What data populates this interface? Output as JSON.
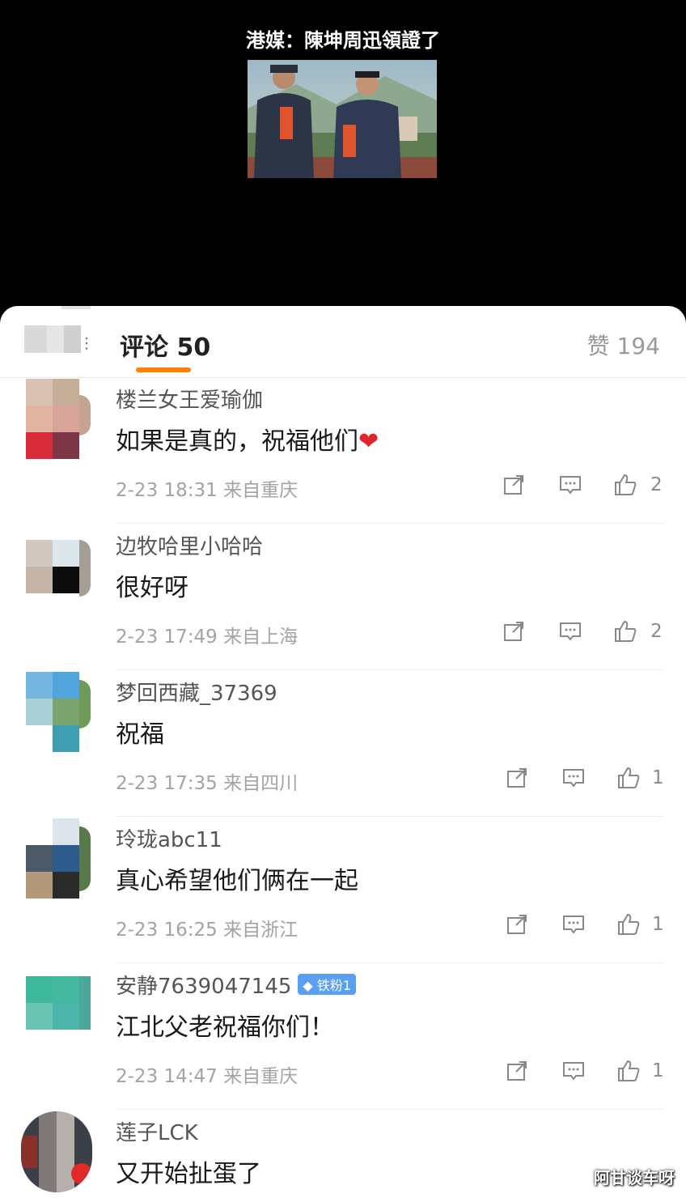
{
  "video": {
    "title": "港媒：陳坤周迅領證了"
  },
  "tabs": {
    "comments_label": "评论 50",
    "likes_label": "赞 194"
  },
  "comments": [
    {
      "username": "楼兰女王爱瑜伽",
      "text": "如果是真的，祝福他们",
      "emoji": "❤",
      "date": "2-23 18:31",
      "location": "来自重庆",
      "likes": "2"
    },
    {
      "username": "边牧哈里小哈哈",
      "text": "很好呀",
      "date": "2-23 17:49",
      "location": "来自上海",
      "likes": "2"
    },
    {
      "username": "梦回西藏_37369",
      "text": "祝福",
      "date": "2-23 17:35",
      "location": "来自四川",
      "likes": "1"
    },
    {
      "username": "玲珑abc11",
      "text": "真心希望他们俩在一起",
      "date": "2-23 16:25",
      "location": "来自浙江",
      "likes": "1"
    },
    {
      "username": "安静7639047145",
      "badge": "铁粉1",
      "text": "江北父老祝福你们！",
      "date": "2-23 14:47",
      "location": "来自重庆",
      "likes": "1"
    },
    {
      "username": "莲子LCK",
      "text": "又开始扯蛋了"
    }
  ],
  "watermark": "阿甘谈车呀",
  "colors": {
    "accent": "#ff8200",
    "background_top": "#000000"
  },
  "icons": [
    "share-icon",
    "comment-icon",
    "thumbs-up-icon"
  ]
}
